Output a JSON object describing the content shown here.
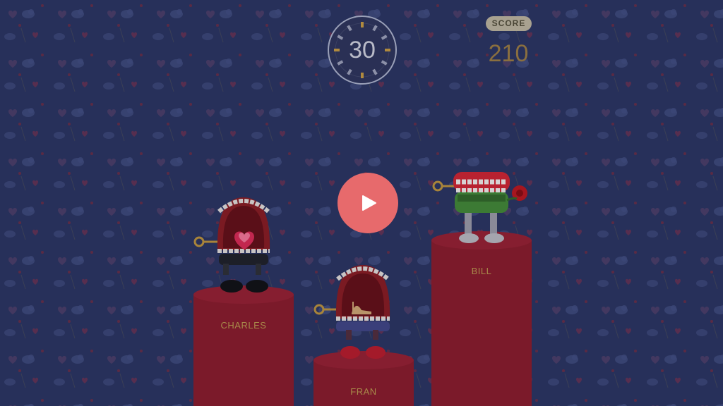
{
  "timer": {
    "value": "30"
  },
  "score": {
    "label": "SCORE",
    "value": "210"
  },
  "play": {
    "icon": "play-icon",
    "color": "#e76a6c"
  },
  "players": [
    {
      "name": "CHARLES",
      "item": "heart-candy-box"
    },
    {
      "name": "FRAN",
      "item": "high-heel-shoe"
    },
    {
      "name": "BILL",
      "item": "red-rose"
    }
  ],
  "colors": {
    "background": "#27305a",
    "podium": "#7b1a2a",
    "accent": "#e76a6c",
    "score_text": "#8a6f3f"
  }
}
